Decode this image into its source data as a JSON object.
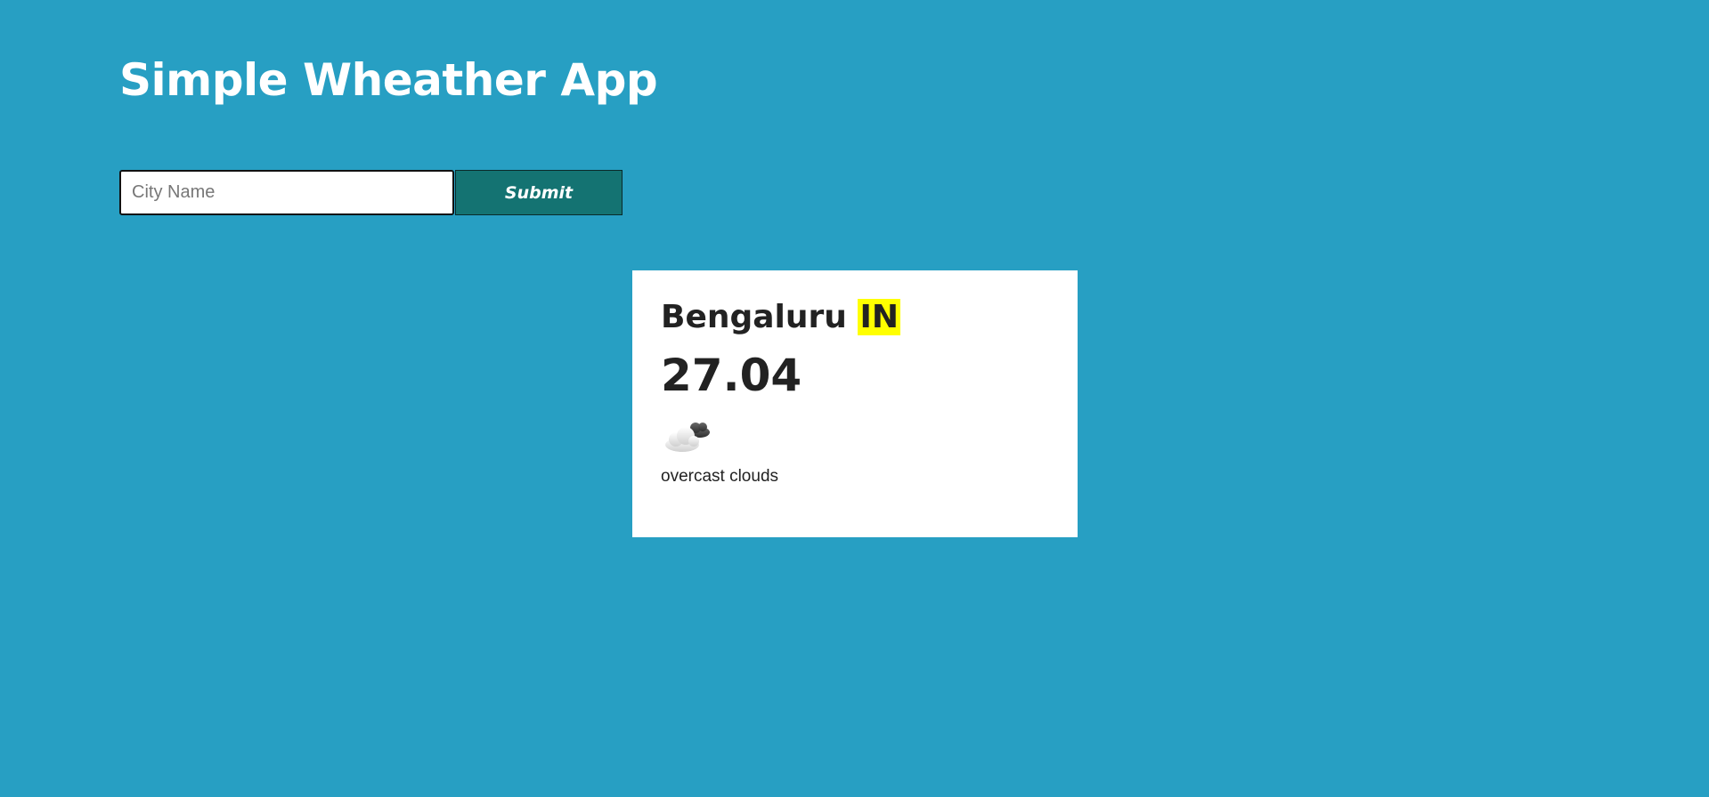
{
  "app": {
    "title": "Simple Wheather App"
  },
  "search": {
    "placeholder": "City Name",
    "value": "",
    "submit_label": "Submit"
  },
  "weather": {
    "city": "Bengaluru",
    "country": "IN",
    "temperature": "27.04",
    "icon": "overcast-clouds-icon",
    "description": "overcast clouds"
  }
}
